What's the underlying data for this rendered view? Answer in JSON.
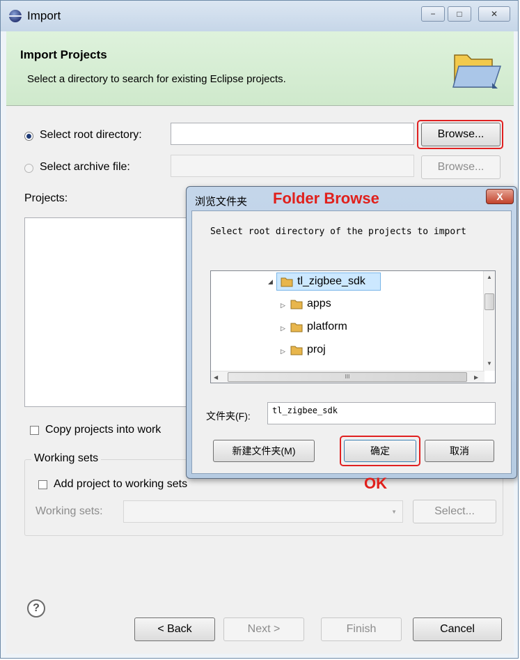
{
  "window": {
    "title": "Import",
    "controls": [
      "−",
      "□",
      "✕"
    ]
  },
  "header": {
    "title": "Import Projects",
    "description": "Select a directory to search for existing Eclipse projects."
  },
  "source": {
    "root_label": "Select root directory:",
    "root_value": "",
    "archive_label": "Select archive file:",
    "archive_value": "",
    "browse_label": "Browse...",
    "browse_archive_label": "Browse..."
  },
  "projects": {
    "label": "Projects:",
    "copy_label": "Copy projects into work"
  },
  "working_sets": {
    "group_label": "Working sets",
    "add_label": "Add project to working sets",
    "sets_label": "Working sets:",
    "select_label": "Select..."
  },
  "footer": {
    "help": "?",
    "back": "< Back",
    "next": "Next >",
    "finish": "Finish",
    "cancel": "Cancel"
  },
  "folder_dialog": {
    "title": "浏览文件夹",
    "annotation": "Folder Browse",
    "close": "X",
    "prompt": "Select root directory of the projects to import",
    "tree": [
      {
        "label": "tl_zigbee_sdk",
        "expanded": true,
        "selected": true
      },
      {
        "label": "apps",
        "expanded": false
      },
      {
        "label": "platform",
        "expanded": false
      },
      {
        "label": "proj",
        "expanded": false
      }
    ],
    "hscroll_grip": "III",
    "folder_label": "文件夹(F):",
    "folder_value": "tl_zigbee_sdk",
    "new_folder": "新建文件夹(M)",
    "ok": "确定",
    "cancel": "取消"
  },
  "ok_annotation": "OK",
  "colors": {
    "annotation": "#e0201c",
    "header_bg": "#d6eed3",
    "selected_node": "#cce8ff"
  },
  "icons": [
    "eclipse-icon",
    "folder-icon",
    "help-icon",
    "close-icon",
    "expand-arrow-icon",
    "dropdown-arrow-icon"
  ]
}
